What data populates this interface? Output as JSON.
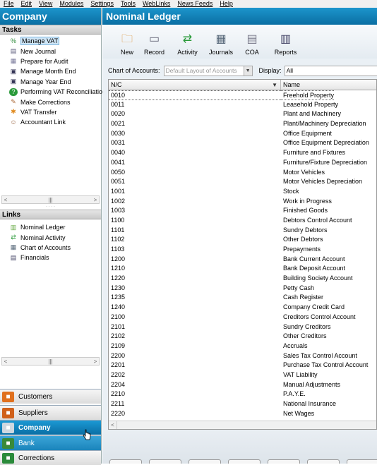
{
  "menu": [
    "File",
    "Edit",
    "View",
    "Modules",
    "Settings",
    "Tools",
    "WebLinks",
    "News Feeds",
    "Help"
  ],
  "left": {
    "title": "Company",
    "tasks_title": "Tasks",
    "tasks": [
      {
        "label": "Manage VAT",
        "icon": "percent-icon",
        "selected": true
      },
      {
        "label": "New Journal",
        "icon": "journal-icon"
      },
      {
        "label": "Prepare for Audit",
        "icon": "audit-icon"
      },
      {
        "label": "Manage Month End",
        "icon": "calendar-icon"
      },
      {
        "label": "Manage Year End",
        "icon": "calendar-icon"
      },
      {
        "label": "Performing VAT Reconciliatio",
        "icon": "help-icon"
      },
      {
        "label": "Make Corrections",
        "icon": "corrections-icon"
      },
      {
        "label": "VAT Transfer",
        "icon": "transfer-icon"
      },
      {
        "label": "Accountant Link",
        "icon": "user-link-icon"
      }
    ],
    "links_title": "Links",
    "links": [
      {
        "label": "Nominal Ledger",
        "icon": "book-icon"
      },
      {
        "label": "Nominal Activity",
        "icon": "activity-icon"
      },
      {
        "label": "Chart of Accounts",
        "icon": "chart-of-accounts-icon"
      },
      {
        "label": "Financials",
        "icon": "financials-icon"
      }
    ],
    "nav": [
      {
        "label": "Customers",
        "style": "grey",
        "icon": "customers-icon"
      },
      {
        "label": "Suppliers",
        "style": "grey",
        "icon": "suppliers-icon"
      },
      {
        "label": "Company",
        "style": "blue",
        "icon": "company-icon"
      },
      {
        "label": "Bank",
        "style": "green",
        "icon": "bank-icon"
      },
      {
        "label": "Corrections",
        "style": "grey",
        "icon": "corrections-nav-icon"
      }
    ]
  },
  "main": {
    "title": "Nominal Ledger",
    "toolbar": [
      {
        "label": "New",
        "icon": "new-icon"
      },
      {
        "label": "Record",
        "icon": "record-icon"
      },
      {
        "label": "Activity",
        "icon": "activity-icon"
      },
      {
        "label": "Journals",
        "icon": "journals-icon"
      },
      {
        "label": "COA",
        "icon": "coa-icon"
      },
      {
        "label": "Reports",
        "icon": "reports-icon"
      }
    ],
    "coa_label": "Chart of Accounts:",
    "coa_value": "Default Layout of Accounts",
    "display_label": "Display:",
    "display_value": "All",
    "columns": {
      "nc": "N/C",
      "name": "Name"
    },
    "rows": [
      [
        "0010",
        "Freehold Property"
      ],
      [
        "0011",
        "Leasehold Property"
      ],
      [
        "0020",
        "Plant and Machinery"
      ],
      [
        "0021",
        "Plant/Machinery Depreciation"
      ],
      [
        "0030",
        "Office Equipment"
      ],
      [
        "0031",
        "Office Equipment Depreciation"
      ],
      [
        "0040",
        "Furniture and Fixtures"
      ],
      [
        "0041",
        "Furniture/Fixture Depreciation"
      ],
      [
        "0050",
        "Motor Vehicles"
      ],
      [
        "0051",
        "Motor Vehicles Depreciation"
      ],
      [
        "1001",
        "Stock"
      ],
      [
        "1002",
        "Work in Progress"
      ],
      [
        "1003",
        "Finished Goods"
      ],
      [
        "1100",
        "Debtors Control Account"
      ],
      [
        "1101",
        "Sundry Debtors"
      ],
      [
        "1102",
        "Other Debtors"
      ],
      [
        "1103",
        "Prepayments"
      ],
      [
        "1200",
        "Bank Current Account"
      ],
      [
        "1210",
        "Bank Deposit Account"
      ],
      [
        "1220",
        "Building Society Account"
      ],
      [
        "1230",
        "Petty Cash"
      ],
      [
        "1235",
        "Cash Register"
      ],
      [
        "1240",
        "Company Credit Card"
      ],
      [
        "2100",
        "Creditors Control Account"
      ],
      [
        "2101",
        "Sundry Creditors"
      ],
      [
        "2102",
        "Other Creditors"
      ],
      [
        "2109",
        "Accruals"
      ],
      [
        "2200",
        "Sales Tax Control Account"
      ],
      [
        "2201",
        "Purchase Tax Control Account"
      ],
      [
        "2202",
        "VAT Liability"
      ],
      [
        "2204",
        "Manual Adjustments"
      ],
      [
        "2210",
        "P.A.Y.E."
      ],
      [
        "2211",
        "National Insurance"
      ],
      [
        "2220",
        "Net Wages"
      ]
    ]
  },
  "colors": {
    "header_blue": "#0b6fa3",
    "selected_bg": "#cfe6f7"
  }
}
